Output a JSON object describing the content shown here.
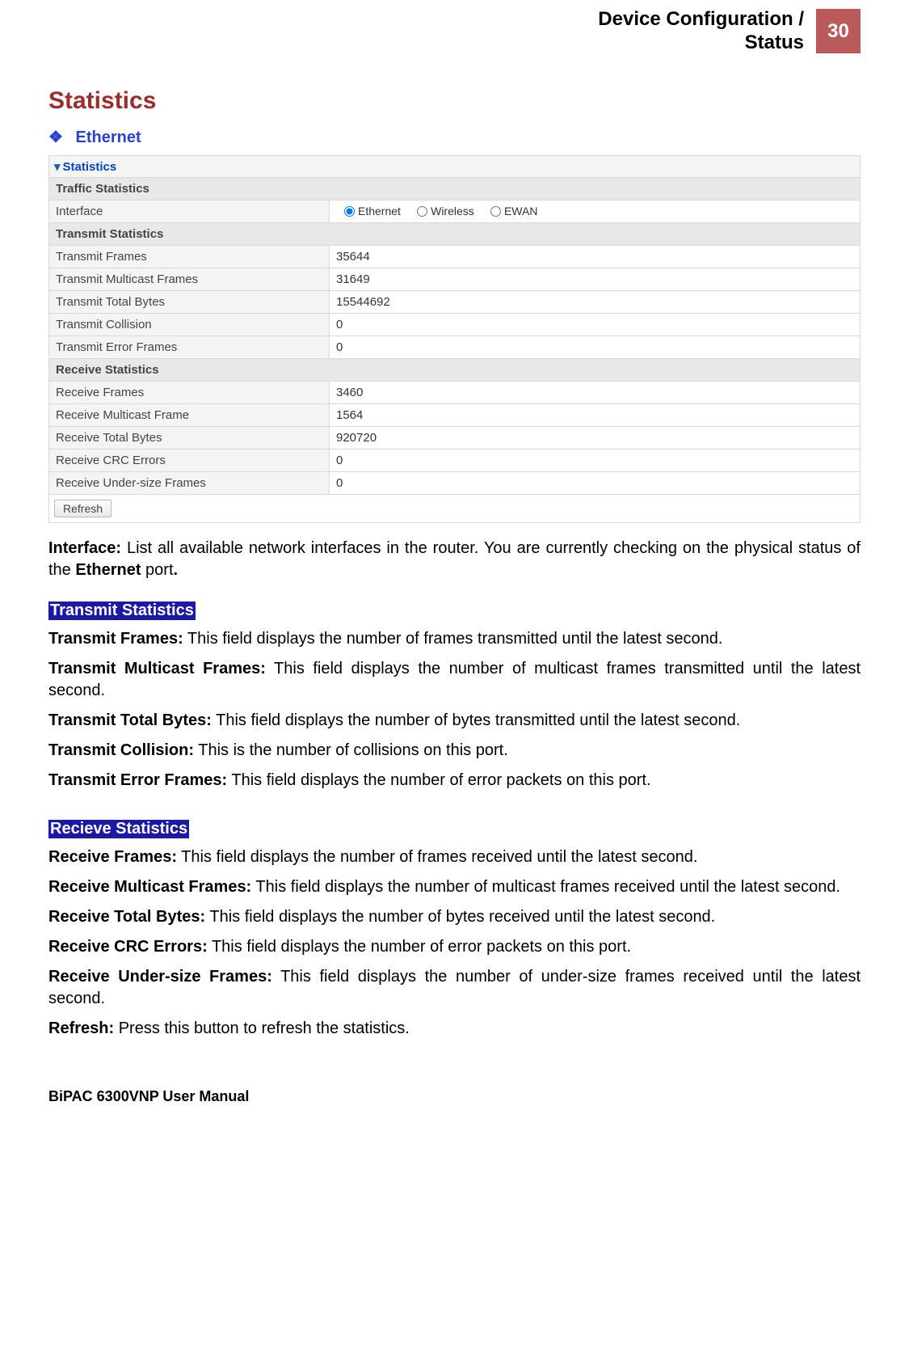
{
  "header": {
    "title_line1": "Device Configuration /",
    "title_line2": "Status",
    "page_number": "30"
  },
  "section_title": "Statistics",
  "subsection_title": "Ethernet",
  "panel_title": "Statistics",
  "traffic_header": "Traffic Statistics",
  "interface_label": "Interface",
  "interface_options": {
    "ethernet": "Ethernet",
    "wireless": "Wireless",
    "ewan": "EWAN"
  },
  "transmit_header": "Transmit Statistics",
  "transmit_rows": [
    {
      "label": "Transmit Frames",
      "value": "35644"
    },
    {
      "label": "Transmit Multicast Frames",
      "value": "31649"
    },
    {
      "label": "Transmit Total Bytes",
      "value": "15544692"
    },
    {
      "label": "Transmit Collision",
      "value": "0"
    },
    {
      "label": "Transmit Error Frames",
      "value": "0"
    }
  ],
  "receive_header": "Receive Statistics",
  "receive_rows": [
    {
      "label": "Receive Frames",
      "value": "3460"
    },
    {
      "label": "Receive Multicast Frame",
      "value": "1564"
    },
    {
      "label": "Receive Total Bytes",
      "value": "920720"
    },
    {
      "label": "Receive CRC Errors",
      "value": "0"
    },
    {
      "label": "Receive Under-size Frames",
      "value": "0"
    }
  ],
  "refresh_button": "Refresh",
  "body": {
    "interface_bold": "Interface:",
    "interface_text": " List all available network interfaces in the router.  You are currently checking on the physical status of the ",
    "interface_bold2": "Ethernet",
    "interface_text2": " port",
    "interface_bold3": ".",
    "tx_group": "Transmit Statistics",
    "tx_items": [
      {
        "b": "Transmit Frames:",
        "t": " This field displays the number of frames transmitted until the latest second."
      },
      {
        "b": "Transmit Multicast Frames:",
        "t": " This field displays the number of multicast frames transmitted until the latest second."
      },
      {
        "b": "Transmit Total Bytes:",
        "t": " This field displays the number of bytes transmitted until the latest second."
      },
      {
        "b": "Transmit Collision:",
        "t": " This is the number of collisions on this port."
      },
      {
        "b": "Transmit Error Frames:",
        "t": " This field displays the number of error packets on this port."
      }
    ],
    "rx_group": "Recieve Statistics",
    "rx_items": [
      {
        "b": "Receive Frames:",
        "t": " This field displays the number of frames received until the latest second."
      },
      {
        "b": "Receive Multicast Frames:",
        "t": " This field displays the number of multicast frames received until the latest second."
      },
      {
        "b": "Receive Total Bytes:",
        "t": " This field displays the number of bytes received until the latest second."
      },
      {
        "b": "Receive CRC Errors:",
        "t": " This field displays the number of error packets on this port."
      },
      {
        "b": "Receive Under-size Frames:",
        "t": " This field displays the number of under-size frames received until the latest second."
      },
      {
        "b": "Refresh:",
        "t": " Press this button to refresh the statistics."
      }
    ]
  },
  "footer": "BiPAC 6300VNP User Manual"
}
